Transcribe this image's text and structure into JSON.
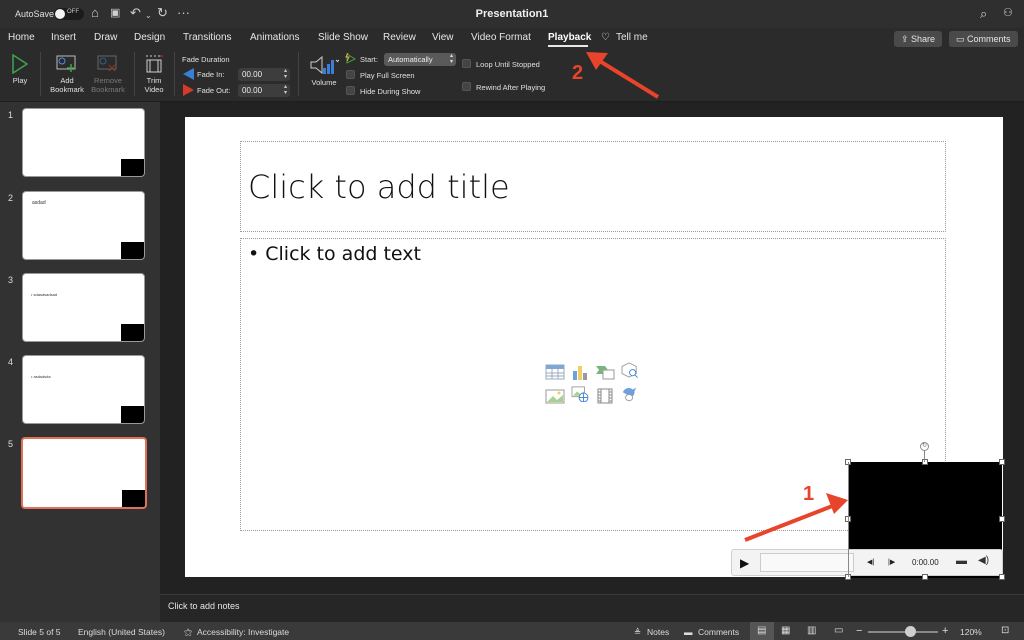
{
  "titlebar": {
    "autosave_label": "AutoSave",
    "autosave_state": "OFF",
    "document_title": "Presentation1",
    "icons": [
      "home-icon",
      "save-icon",
      "undo-icon",
      "chevron-down-icon",
      "redo-icon",
      "more-icon",
      "search-icon",
      "account-icon"
    ]
  },
  "tabs": [
    {
      "label": "Home"
    },
    {
      "label": "Insert"
    },
    {
      "label": "Draw"
    },
    {
      "label": "Design"
    },
    {
      "label": "Transitions"
    },
    {
      "label": "Animations"
    },
    {
      "label": "Slide Show"
    },
    {
      "label": "Review"
    },
    {
      "label": "View"
    },
    {
      "label": "Video Format"
    },
    {
      "label": "Playback",
      "active": true
    },
    {
      "label": "Tell me"
    }
  ],
  "header_buttons": {
    "share": "Share",
    "comments": "Comments"
  },
  "ribbon": {
    "play": "Play",
    "add_bookmark_1": "Add",
    "add_bookmark_2": "Bookmark",
    "remove_bookmark_1": "Remove",
    "remove_bookmark_2": "Bookmark",
    "trim_1": "Trim",
    "trim_2": "Video",
    "fade_duration": "Fade Duration",
    "fade_in_label": "Fade In:",
    "fade_in_value": "00.00",
    "fade_out_label": "Fade Out:",
    "fade_out_value": "00.00",
    "volume": "Volume",
    "start_label": "Start:",
    "start_value": "Automatically",
    "play_full_screen": "Play Full Screen",
    "hide_during_show": "Hide During Show",
    "loop_until_stopped": "Loop Until Stopped",
    "rewind_after_playing": "Rewind After Playing"
  },
  "slides": [
    {
      "number": "1",
      "text": ""
    },
    {
      "number": "2",
      "text": "asdad"
    },
    {
      "number": "3",
      "text": "• sdasdsadsad"
    },
    {
      "number": "4",
      "text": "• asdsdsda"
    },
    {
      "number": "5",
      "text": "",
      "selected": true
    }
  ],
  "slide": {
    "title_placeholder": "Click to add title",
    "body_placeholder": "• Click to add text",
    "insert_icons": [
      "table-icon",
      "chart-icon",
      "smartart-icon",
      "3d-model-icon",
      "picture-icon",
      "online-picture-icon",
      "video-icon",
      "icons-icon"
    ]
  },
  "video_player": {
    "time": "0:00.00"
  },
  "notes_placeholder": "Click to add notes",
  "status": {
    "slide_counter": "Slide 5 of 5",
    "language": "English (United States)",
    "accessibility": "Accessibility: Investigate",
    "notes": "Notes",
    "comments": "Comments",
    "zoom": "120%",
    "zoom_fraction": 0.6
  },
  "annotations": [
    {
      "label": "1",
      "color": "#e8432b"
    },
    {
      "label": "2",
      "color": "#e8432b"
    }
  ]
}
